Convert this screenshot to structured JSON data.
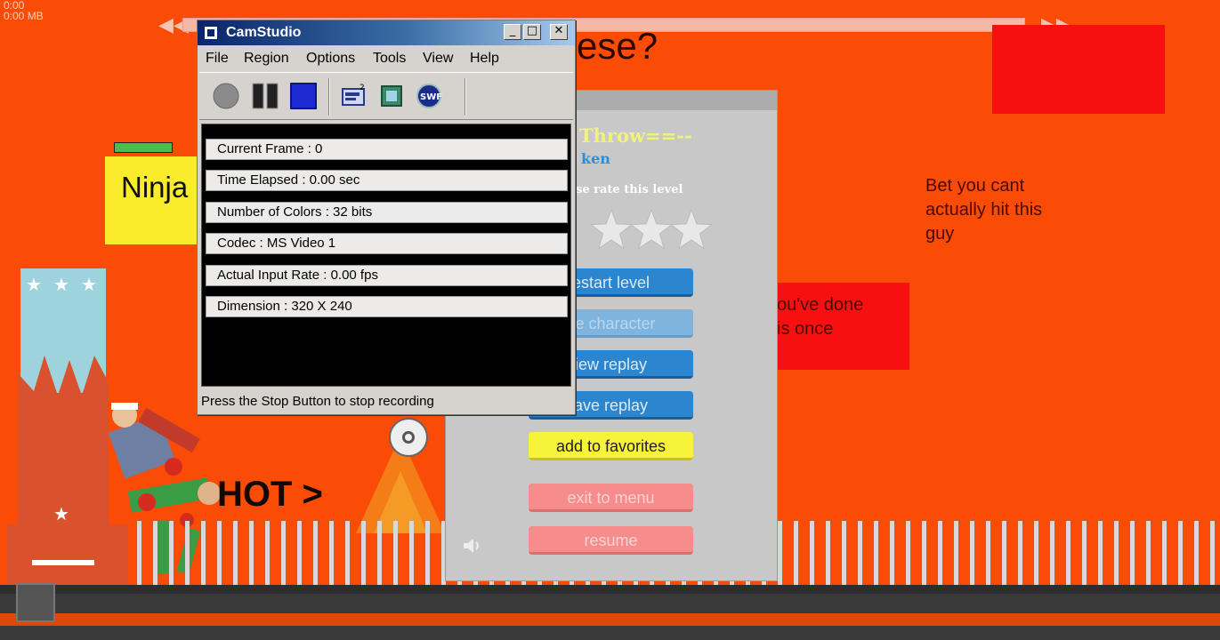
{
  "overlay": {
    "top_left_text_1": "0:00",
    "top_left_text_2": "0:00 MB"
  },
  "game": {
    "question_text": "ese?",
    "ninja_text": "Ninja",
    "hot_text": "HOT >",
    "bet_text_lines": [
      "Bet you cant",
      "actually hit this",
      "guy"
    ],
    "done_text_lines": [
      "ou've done",
      "is once"
    ],
    "rewind_glyph": "◀◀",
    "forward_glyph": "▶▶",
    "tower_star_glyph": "★",
    "colors": {
      "background": "#fa4c06",
      "red_box": "#f7100f",
      "yellow_box": "#f9ec2a"
    }
  },
  "pause_panel": {
    "title": "Throw==--",
    "subtitle": "ken",
    "rate_label": "se rate this level",
    "star_count": 3,
    "buttons": {
      "restart": "estart level",
      "change_character": "ge character",
      "view_replay": "iew replay",
      "save_replay": "ave replay",
      "add_favorites": "add to favorites",
      "exit_menu": "exit to menu",
      "resume": "resume"
    }
  },
  "camstudio": {
    "title": "CamStudio",
    "window_buttons": {
      "minimize": "_",
      "maximize": "□",
      "close": "✕"
    },
    "menu": [
      "File",
      "Region",
      "Options",
      "Tools",
      "View",
      "Help"
    ],
    "toolbar_icons": [
      "record-icon",
      "pause-icon",
      "stop-icon",
      "region-icon",
      "annotation-icon",
      "swf-icon"
    ],
    "swf_label": "SWF",
    "info": {
      "current_frame": "Current Frame : 0",
      "time_elapsed": "Time Elapsed : 0.00 sec",
      "number_of_colors": "Number of Colors : 32 bits",
      "codec": "Codec : MS Video 1",
      "actual_input_rate": "Actual Input Rate : 0.00 fps",
      "dimension": "Dimension : 320 X 240"
    },
    "status": "Press the Stop Button to stop recording"
  }
}
